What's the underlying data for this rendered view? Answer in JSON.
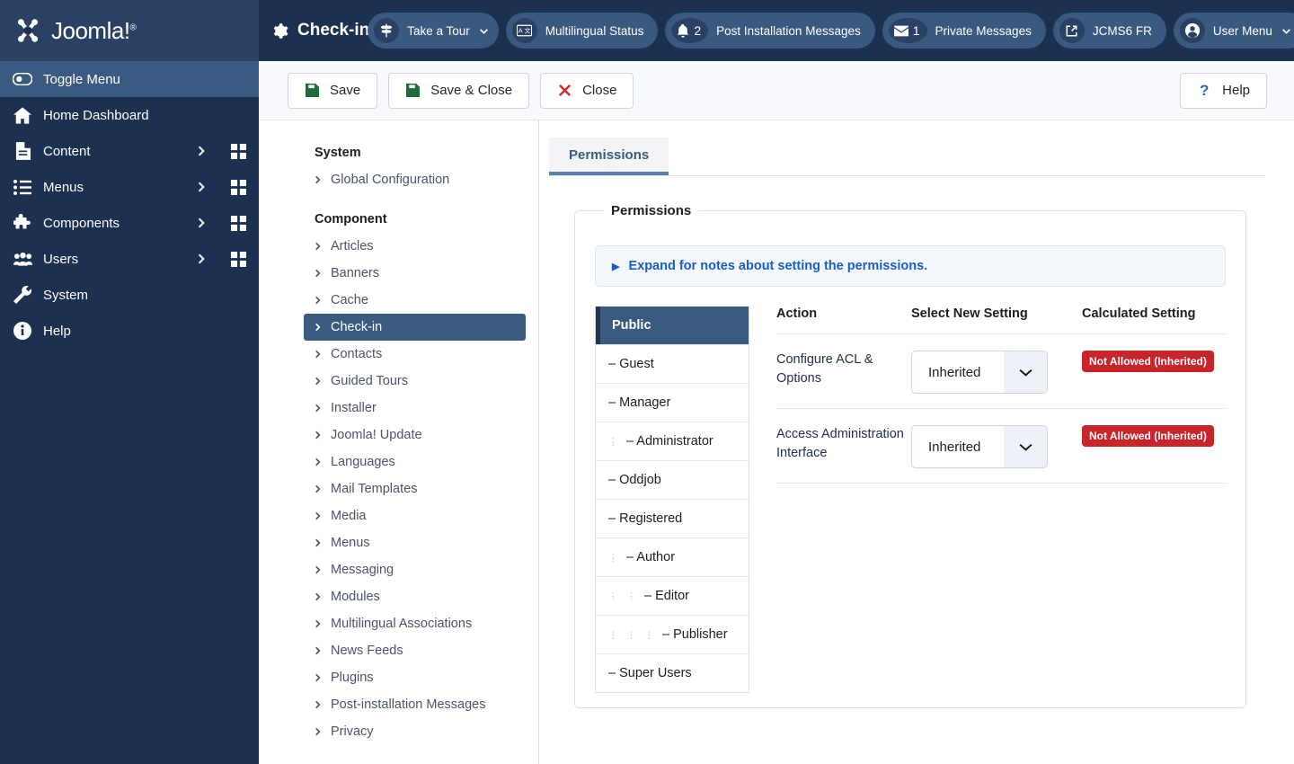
{
  "header": {
    "brand_name": "Joomla!",
    "brand_tm": "®",
    "page_title": "Check-in: Op",
    "pills": [
      {
        "label": "Take a Tour",
        "icon": "signpost-icon",
        "count": null,
        "has_chevron": true
      },
      {
        "label": "Multilingual Status",
        "icon": "translate-icon",
        "count": null,
        "has_chevron": false
      },
      {
        "label": "Post Installation Messages",
        "icon": "bell-icon",
        "count": "2",
        "has_chevron": false
      },
      {
        "label": "Private Messages",
        "icon": "envelope-icon",
        "count": "1",
        "has_chevron": false
      },
      {
        "label": "JCMS6 FR",
        "icon": "external-link-icon",
        "count": null,
        "has_chevron": false
      },
      {
        "label": "User Menu",
        "icon": "user-circle-icon",
        "count": null,
        "has_chevron": true
      }
    ],
    "overflow_label": "•••"
  },
  "sidebar": {
    "toggle_label": "Toggle Menu",
    "items": [
      {
        "label": "Home Dashboard",
        "icon": "home-icon",
        "has_arrow": false,
        "has_grid": false
      },
      {
        "label": "Content",
        "icon": "document-icon",
        "has_arrow": true,
        "has_grid": true
      },
      {
        "label": "Menus",
        "icon": "list-icon",
        "has_arrow": true,
        "has_grid": true
      },
      {
        "label": "Components",
        "icon": "puzzle-icon",
        "has_arrow": true,
        "has_grid": true
      },
      {
        "label": "Users",
        "icon": "users-icon",
        "has_arrow": true,
        "has_grid": true
      },
      {
        "label": "System",
        "icon": "wrench-icon",
        "has_arrow": false,
        "has_grid": false
      },
      {
        "label": "Help",
        "icon": "info-icon",
        "has_arrow": false,
        "has_grid": false
      }
    ]
  },
  "toolbar": {
    "save_label": "Save",
    "save_close_label": "Save & Close",
    "close_label": "Close",
    "help_label": "Help",
    "help_icon": "question-mark-icon"
  },
  "config_menu": {
    "system_heading": "System",
    "system_items": [
      {
        "label": "Global Configuration",
        "active": false
      }
    ],
    "component_heading": "Component",
    "component_items": [
      {
        "label": "Articles",
        "active": false
      },
      {
        "label": "Banners",
        "active": false
      },
      {
        "label": "Cache",
        "active": false
      },
      {
        "label": "Check-in",
        "active": true
      },
      {
        "label": "Contacts",
        "active": false
      },
      {
        "label": "Guided Tours",
        "active": false
      },
      {
        "label": "Installer",
        "active": false
      },
      {
        "label": "Joomla! Update",
        "active": false
      },
      {
        "label": "Languages",
        "active": false
      },
      {
        "label": "Mail Templates",
        "active": false
      },
      {
        "label": "Media",
        "active": false
      },
      {
        "label": "Menus",
        "active": false
      },
      {
        "label": "Messaging",
        "active": false
      },
      {
        "label": "Modules",
        "active": false
      },
      {
        "label": "Multilingual Associations",
        "active": false
      },
      {
        "label": "News Feeds",
        "active": false
      },
      {
        "label": "Plugins",
        "active": false
      },
      {
        "label": "Post-installation Messages",
        "active": false
      },
      {
        "label": "Privacy",
        "active": false
      }
    ]
  },
  "panel": {
    "tab_label": "Permissions",
    "fieldset_legend": "Permissions",
    "notes_label": "Expand for notes about setting the permissions.",
    "groups": [
      {
        "label": "Public",
        "depth": 0,
        "active": true,
        "prefix": ""
      },
      {
        "label": "Guest",
        "depth": 0,
        "active": false,
        "prefix": "–"
      },
      {
        "label": "Manager",
        "depth": 0,
        "active": false,
        "prefix": "–"
      },
      {
        "label": "Administrator",
        "depth": 1,
        "active": false,
        "prefix": "–"
      },
      {
        "label": "Oddjob",
        "depth": 0,
        "active": false,
        "prefix": "–"
      },
      {
        "label": "Registered",
        "depth": 0,
        "active": false,
        "prefix": "–"
      },
      {
        "label": "Author",
        "depth": 1,
        "active": false,
        "prefix": "–"
      },
      {
        "label": "Editor",
        "depth": 2,
        "active": false,
        "prefix": "–"
      },
      {
        "label": "Publisher",
        "depth": 3,
        "active": false,
        "prefix": "–"
      },
      {
        "label": "Super Users",
        "depth": 0,
        "active": false,
        "prefix": "–"
      }
    ],
    "table": {
      "columns": [
        "Action",
        "Select New Setting",
        "Calculated Setting"
      ],
      "rows": [
        {
          "action": "Configure ACL & Options",
          "setting_value": "Inherited",
          "calculated": "Not Allowed (Inherited)"
        },
        {
          "action": "Access Administration Interface",
          "setting_value": "Inherited",
          "calculated": "Not Allowed (Inherited)"
        }
      ]
    }
  },
  "colors": {
    "brand_dark": "#1c3050",
    "brand_mid": "#2a4163",
    "accent_blue": "#3b5a80",
    "link_blue": "#1a5ec4",
    "danger_red": "#c8242b",
    "toolbar_bg": "#f7f9fc"
  }
}
